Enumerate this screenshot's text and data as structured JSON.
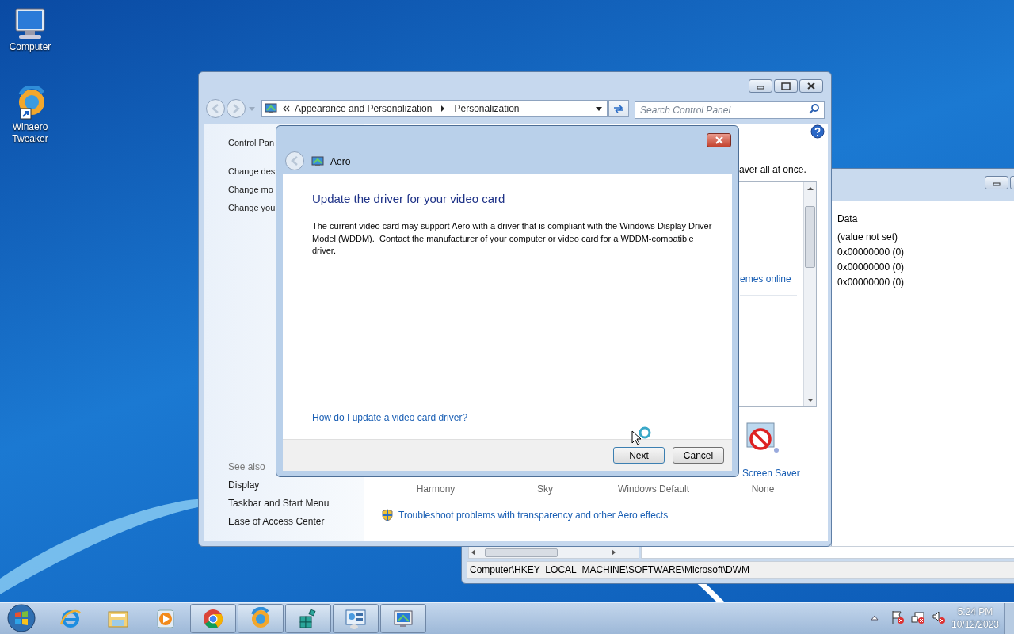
{
  "desktop_icons": [
    {
      "label": "Computer",
      "kind": "computer"
    },
    {
      "label": "Winaero Tweaker",
      "kind": "shortcut"
    }
  ],
  "registry": {
    "columns": [
      "Data"
    ],
    "rows": [
      "(value not set)",
      "0x00000000 (0)",
      "0x00000000 (0)",
      "0x00000000 (0)"
    ],
    "status_path": "Computer\\HKEY_LOCAL_MACHINE\\SOFTWARE\\Microsoft\\DWM"
  },
  "control_panel": {
    "breadcrumbs": [
      "Appearance and Personalization",
      "Personalization"
    ],
    "search": {
      "placeholder": "Search Control Panel"
    },
    "sidebar": {
      "top_links": [
        "Control Pan",
        "Change des",
        "Change mo",
        "Change you"
      ],
      "see_also_heading": "See also",
      "see_also": [
        "Display",
        "Taskbar and Start Menu",
        "Ease of Access Center"
      ]
    },
    "main": {
      "intro_fragment": "aver all at once.",
      "online_link_fragment": "emes online",
      "screen_saver": {
        "label": "Screen Saver",
        "value": "None"
      },
      "theme_labels": [
        "Harmony",
        "Sky",
        "Windows Default"
      ],
      "troubleshoot_link": "Troubleshoot problems with transparency and other Aero effects"
    }
  },
  "dialog": {
    "title": "Aero",
    "heading": "Update the driver for your video card",
    "body": "The current video card may support Aero with a driver that is compliant with the Windows Display Driver Model (WDDM).  Contact the manufacturer of your computer or video card for a WDDM-compatible driver.",
    "help_link": "How do I update a video card driver?",
    "buttons": [
      "Next",
      "Cancel"
    ]
  },
  "taskbar": {
    "items": [
      {
        "kind": "browser-e",
        "running": false
      },
      {
        "kind": "folder",
        "running": false
      },
      {
        "kind": "media",
        "running": false
      },
      {
        "kind": "chrome",
        "running": true
      },
      {
        "kind": "swirl",
        "running": true
      },
      {
        "kind": "cubes",
        "running": true
      },
      {
        "kind": "panel",
        "running": true
      },
      {
        "kind": "monitor",
        "running": true
      }
    ],
    "clock": {
      "time": "5:24 PM",
      "date": "10/12/2023"
    }
  }
}
